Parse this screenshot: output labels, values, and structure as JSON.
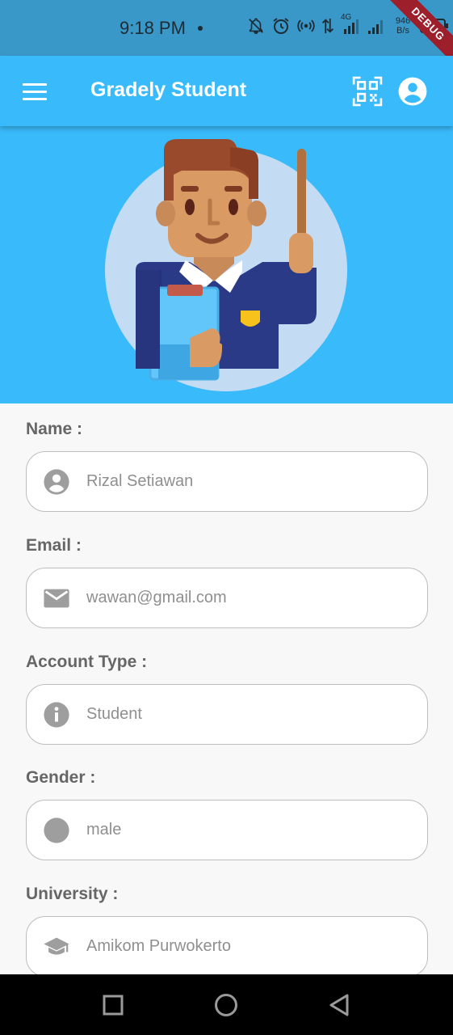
{
  "status_bar": {
    "time": "9:18 PM",
    "network_speed_value": "946",
    "network_speed_unit": "B/s",
    "network_type": "4G",
    "debug_banner": "DEBUG",
    "icons": [
      "notifications-off-icon",
      "alarm-icon",
      "hotspot-icon",
      "data-transfer-icon",
      "signal-4g-icon",
      "signal-icon",
      "battery-icon"
    ]
  },
  "app_bar": {
    "title": "Gradely Student",
    "icons": [
      "menu-icon",
      "qr-code-icon",
      "account-circle-icon"
    ]
  },
  "form": {
    "fields": [
      {
        "label": "Name :",
        "value": "Rizal Setiawan",
        "icon": "person-icon"
      },
      {
        "label": "Email :",
        "value": "wawan@gmail.com",
        "icon": "mail-icon"
      },
      {
        "label": "Account Type :",
        "value": "Student",
        "icon": "info-icon"
      },
      {
        "label": "Gender :",
        "value": "male",
        "icon": "circle-icon"
      },
      {
        "label": "University :",
        "value": "Amikom Purwokerto",
        "icon": "school-icon"
      }
    ]
  },
  "nav_bar": {
    "icons": [
      "recents-square-icon",
      "home-circle-icon",
      "back-triangle-icon"
    ]
  },
  "colors": {
    "primary": "#39bbfb",
    "status_bar": "#3a98c8",
    "field_text": "#8f8f8f",
    "label_text": "#666666",
    "field_icon": "#9e9e9e"
  }
}
